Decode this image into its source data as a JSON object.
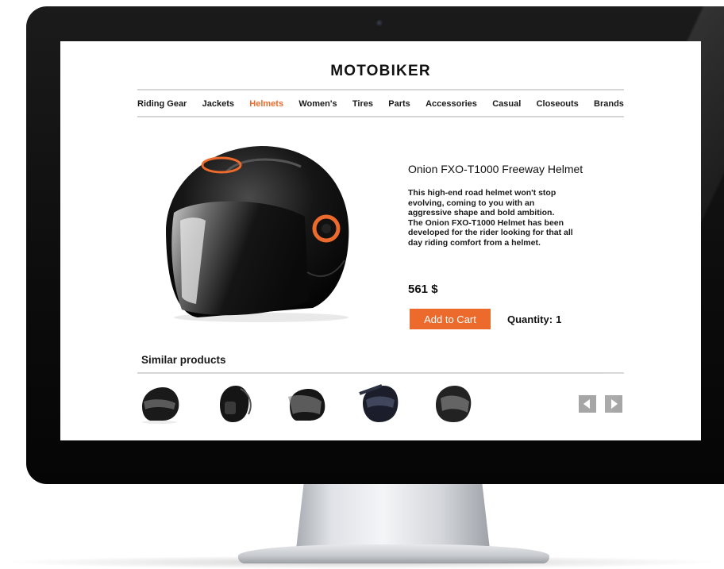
{
  "site": {
    "logo": "MOTOBIKER"
  },
  "nav": {
    "items": [
      {
        "label": "Riding Gear",
        "active": false
      },
      {
        "label": "Jackets",
        "active": false
      },
      {
        "label": "Helmets",
        "active": true
      },
      {
        "label": "Women's",
        "active": false
      },
      {
        "label": "Tires",
        "active": false
      },
      {
        "label": "Parts",
        "active": false
      },
      {
        "label": "Accessories",
        "active": false
      },
      {
        "label": "Casual",
        "active": false
      },
      {
        "label": "Closeouts",
        "active": false
      },
      {
        "label": "Brands",
        "active": false
      }
    ]
  },
  "product": {
    "title": "Onion FXO-T1000 Freeway Helmet",
    "description_lines": [
      "This high-end road helmet won't stop",
      "evolving, coming to you with an",
      "aggressive shape and bold ambition.",
      "The Onion FXO-T1000 Helmet has been",
      "developed for the rider looking for that all",
      "day riding comfort from a helmet."
    ],
    "price": "561 $",
    "add_to_cart_label": "Add to Cart",
    "quantity_label": "Quantity:",
    "quantity_value": "1",
    "image_icon": "motorcycle-helmet-icon"
  },
  "similar": {
    "title": "Similar products",
    "thumbnails": [
      "helmet-thumbnail-icon",
      "helmet-thumbnail-icon",
      "helmet-thumbnail-icon",
      "helmet-thumbnail-icon",
      "helmet-thumbnail-icon"
    ],
    "prev_icon": "arrow-left-icon",
    "next_icon": "arrow-right-icon"
  },
  "colors": {
    "accent": "#ec6a2c",
    "text": "#111111",
    "divider": "#d6d6d6",
    "arrow_button": "#a6a6a6"
  }
}
